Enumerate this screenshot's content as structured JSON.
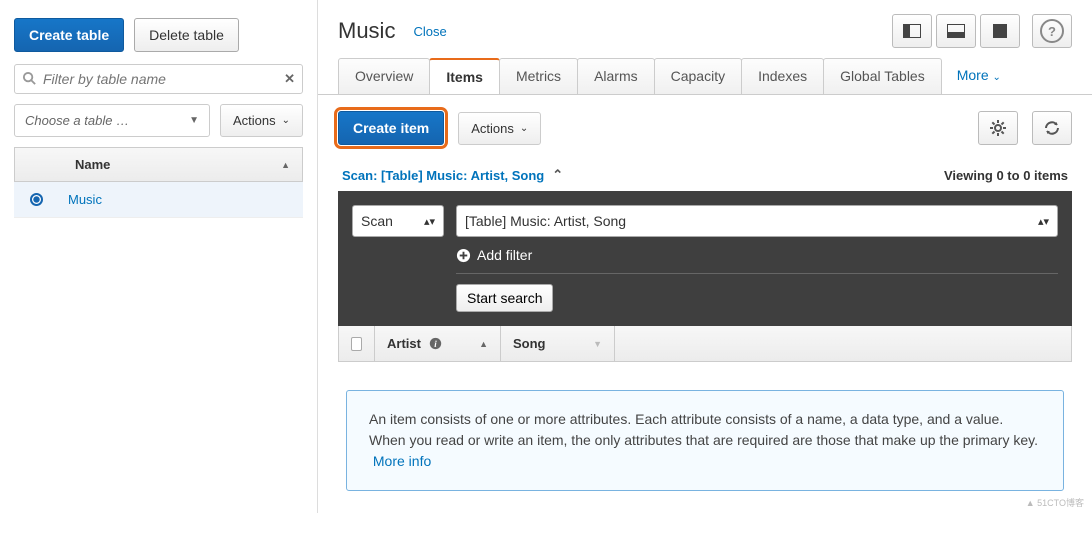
{
  "sidebar": {
    "create_table_btn": "Create table",
    "delete_table_btn": "Delete table",
    "filter_placeholder": "Filter by table name",
    "choose_table_placeholder": "Choose a table …",
    "actions_btn": "Actions",
    "column_name": "Name",
    "rows": [
      {
        "name": "Music",
        "selected": true
      }
    ]
  },
  "main": {
    "title": "Music",
    "close_label": "Close",
    "tabs": [
      "Overview",
      "Items",
      "Metrics",
      "Alarms",
      "Capacity",
      "Indexes",
      "Global Tables"
    ],
    "active_tab": "Items",
    "more_label": "More",
    "create_item_btn": "Create item",
    "actions_btn": "Actions",
    "scan_title": "Scan: [Table] Music: Artist, Song",
    "viewing_text": "Viewing 0 to 0 items",
    "scan_mode": "Scan",
    "scan_target": "[Table] Music: Artist, Song",
    "add_filter": "Add filter",
    "start_search": "Start search",
    "columns": [
      "Artist",
      "Song"
    ],
    "info_text": "An item consists of one or more attributes. Each attribute consists of a name, a data type, and a value. When you read or write an item, the only attributes that are required are those that make up the primary key.",
    "more_info": "More info"
  },
  "watermark": "▲ 51CTO博客"
}
